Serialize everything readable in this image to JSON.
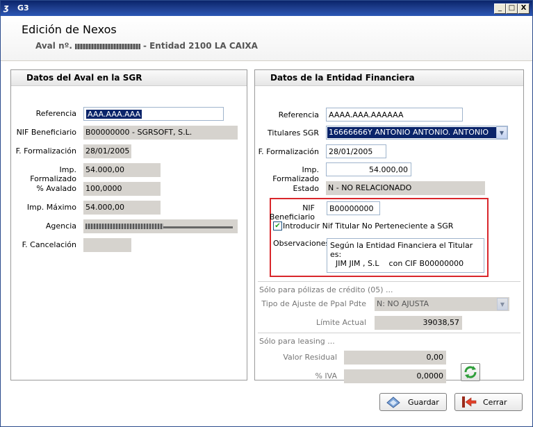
{
  "window": {
    "title": "G3",
    "logo": "G3-logo",
    "minimize": "_",
    "maximize": "□",
    "close": "X"
  },
  "header": {
    "title": "Edición de Nexos",
    "sub_prefix": "Aval nº.",
    "sub_suffix": "- Entidad 2100 LA CAIXA"
  },
  "left": {
    "title": "Datos del Aval en la SGR",
    "fields": [
      {
        "label": "Referencia",
        "value": "AAA.AAA.AAA"
      },
      {
        "label": "NIF Beneficiario",
        "value": "B00000000 - SGRSOFT, S.L."
      },
      {
        "label": "F. Formalización",
        "value": "28/01/2005"
      },
      {
        "label": "Imp. Formalizado",
        "value": "54.000,00"
      },
      {
        "label": "% Avalado",
        "value": "100,0000"
      },
      {
        "label": "Imp. Máximo",
        "value": "54.000,00"
      },
      {
        "label": "Agencia",
        "value": ""
      },
      {
        "label": "F. Cancelación",
        "value": ""
      }
    ]
  },
  "right": {
    "title": "Datos de la Entidad Financiera",
    "fields": [
      {
        "label": "Referencia",
        "value": "AAAA.AAA.AAAAAA"
      },
      {
        "label": "Titulares SGR",
        "value": "16666666Y ANTONIO ANTONIO. ANTONIO"
      },
      {
        "label": "F. Formalización",
        "value": "28/01/2005"
      },
      {
        "label": "Imp. Formalizado",
        "value": "54.000,00"
      },
      {
        "label": "Estado",
        "value": "N - NO RELACIONADO"
      }
    ],
    "nif_label": "NIF Beneficiario",
    "nif_value": "B00000000",
    "checkbox_label": "Introducir Nif Titular No Perteneciente a SGR",
    "obs_label": "Observaciones",
    "obs_line1": "Según la Entidad Financiera el Titular es:",
    "obs_line2": "JIM JIM , S.L    con CIF B00000000",
    "credit_section": "Sólo para pólizas de crédito (05) ...",
    "ajuste_label": "Tipo de Ajuste de Ppal Pdte",
    "ajuste_value": "N: NO AJUSTA",
    "limite_label": "Límite Actual",
    "limite_value": "39038,57",
    "leasing_section": "Sólo para leasing ...",
    "residual_label": "Valor Residual",
    "residual_value": "0,00",
    "iva_label": "% IVA",
    "iva_value": "0,0000"
  },
  "buttons": {
    "save": "Guardar",
    "close": "Cerrar"
  },
  "colors": {
    "selection": "#0a246a",
    "highlight_border": "#d9262b",
    "titlebar": "#0a246a"
  }
}
